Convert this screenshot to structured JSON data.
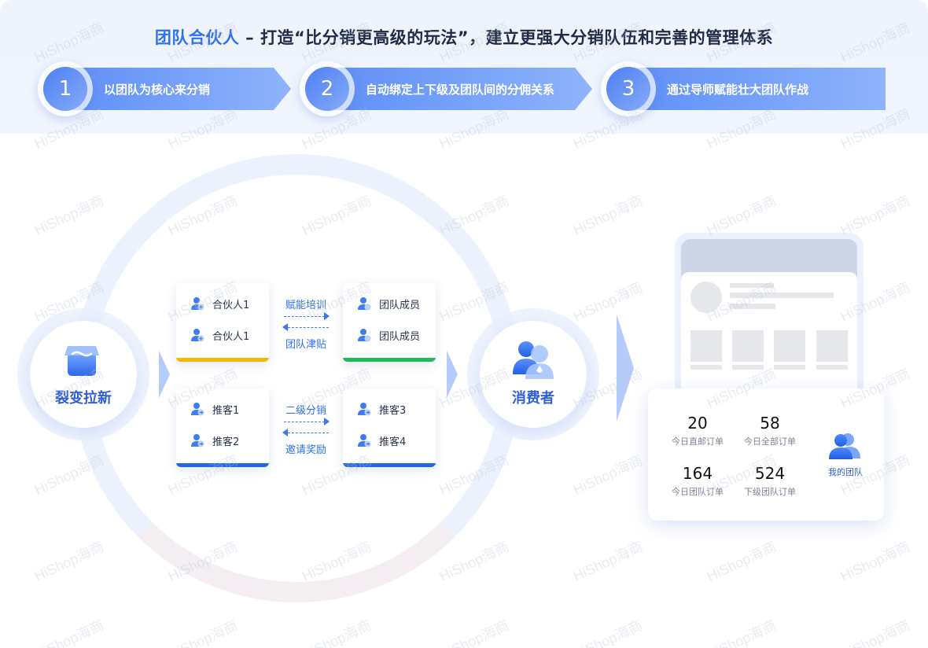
{
  "header": {
    "title_highlight": "团队合伙人",
    "title_rest": " – 打造“比分销更高级的玩法”，建立更强大分销队伍和完善的管理体系",
    "steps": [
      {
        "num": "1",
        "label": "以团队为核心来分销"
      },
      {
        "num": "2",
        "label": "自动绑定上下级及团队间的分佣关系"
      },
      {
        "num": "3",
        "label": "通过导师赋能壮大团队作战"
      }
    ]
  },
  "nodes": {
    "left": "裂变拉新",
    "right": "消费者"
  },
  "cards": {
    "top_left": [
      "合伙人1",
      "合伙人1"
    ],
    "top_right": [
      "团队成员",
      "团队成员"
    ],
    "bottom_left": [
      "推客1",
      "推客2"
    ],
    "bottom_right": [
      "推客3",
      "推客4"
    ]
  },
  "flows": {
    "top_forward": "赋能培训",
    "top_back": "团队津贴",
    "bottom_forward": "二级分销",
    "bottom_back": "邀请奖励"
  },
  "stats": {
    "items": [
      {
        "value": "20",
        "caption": "今日直邮订单"
      },
      {
        "value": "58",
        "caption": "今日全部订单"
      },
      {
        "value": "164",
        "caption": "今日团队订单"
      },
      {
        "value": "524",
        "caption": "下级团队订单"
      }
    ],
    "team_label": "我的团队"
  },
  "watermark": "HiShop海商",
  "colors": {
    "primary": "#2f6ff0",
    "step_gradient_start": "#5e8ef6",
    "strip_yellow": "#f5b800",
    "strip_green": "#22b85a",
    "strip_blue": "#2167e8"
  }
}
